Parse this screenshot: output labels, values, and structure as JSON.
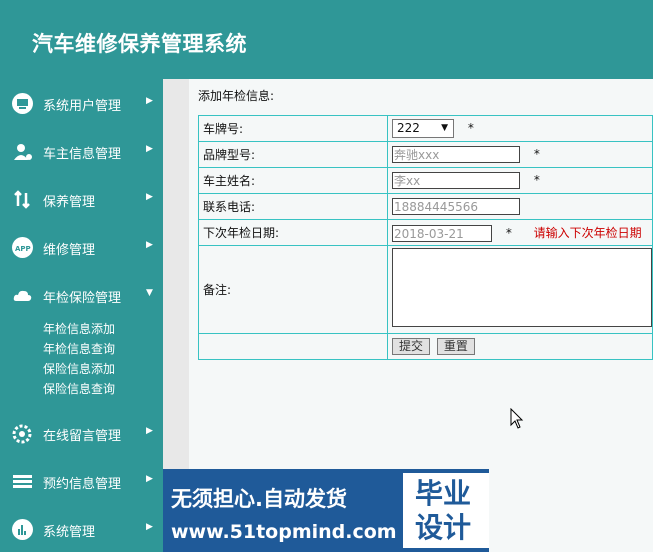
{
  "header": {
    "title": "汽车维修保养管理系统"
  },
  "sidebar": {
    "items": [
      {
        "label": "系统用户管理",
        "icon": "monitor-icon",
        "arrow": "▶"
      },
      {
        "label": "车主信息管理",
        "icon": "user-gear-icon",
        "arrow": "▶"
      },
      {
        "label": "保养管理",
        "icon": "swap-arrows-icon",
        "arrow": "▶"
      },
      {
        "label": "维修管理",
        "icon": "app-icon",
        "arrow": "▶"
      },
      {
        "label": "年检保险管理",
        "icon": "cloud-icon",
        "arrow": "▼"
      },
      {
        "label": "在线留言管理",
        "icon": "gear-icon",
        "arrow": "▶"
      },
      {
        "label": "预约信息管理",
        "icon": "stack-icon",
        "arrow": "▶"
      },
      {
        "label": "系统管理",
        "icon": "bar-chart-icon",
        "arrow": "▶"
      }
    ],
    "submenu": [
      "年检信息添加",
      "年检信息查询",
      "保险信息添加",
      "保险信息查询"
    ]
  },
  "form": {
    "section_title": "添加年检信息:",
    "plate_label": "车牌号:",
    "plate_value": "222",
    "model_label": "品牌型号:",
    "model_value": "奔驰xxx",
    "owner_label": "车主姓名:",
    "owner_value": "李xx",
    "phone_label": "联系电话:",
    "phone_value": "18884445566",
    "date_label": "下次年检日期:",
    "date_value": "2018-03-21",
    "date_hint": "请输入下次年检日期",
    "remark_label": "备注:",
    "required_mark": "*",
    "submit_label": "提交",
    "reset_label": "重置"
  },
  "banner": {
    "line1": "无须担心.自动发货",
    "line2": "www.51topmind.com",
    "badge_line1": "毕业",
    "badge_line2": "设计"
  },
  "colors": {
    "teal": "#2f9797",
    "border": "#38c3c3",
    "hint_red": "#cc0000",
    "banner_blue": "#1f5a99"
  }
}
